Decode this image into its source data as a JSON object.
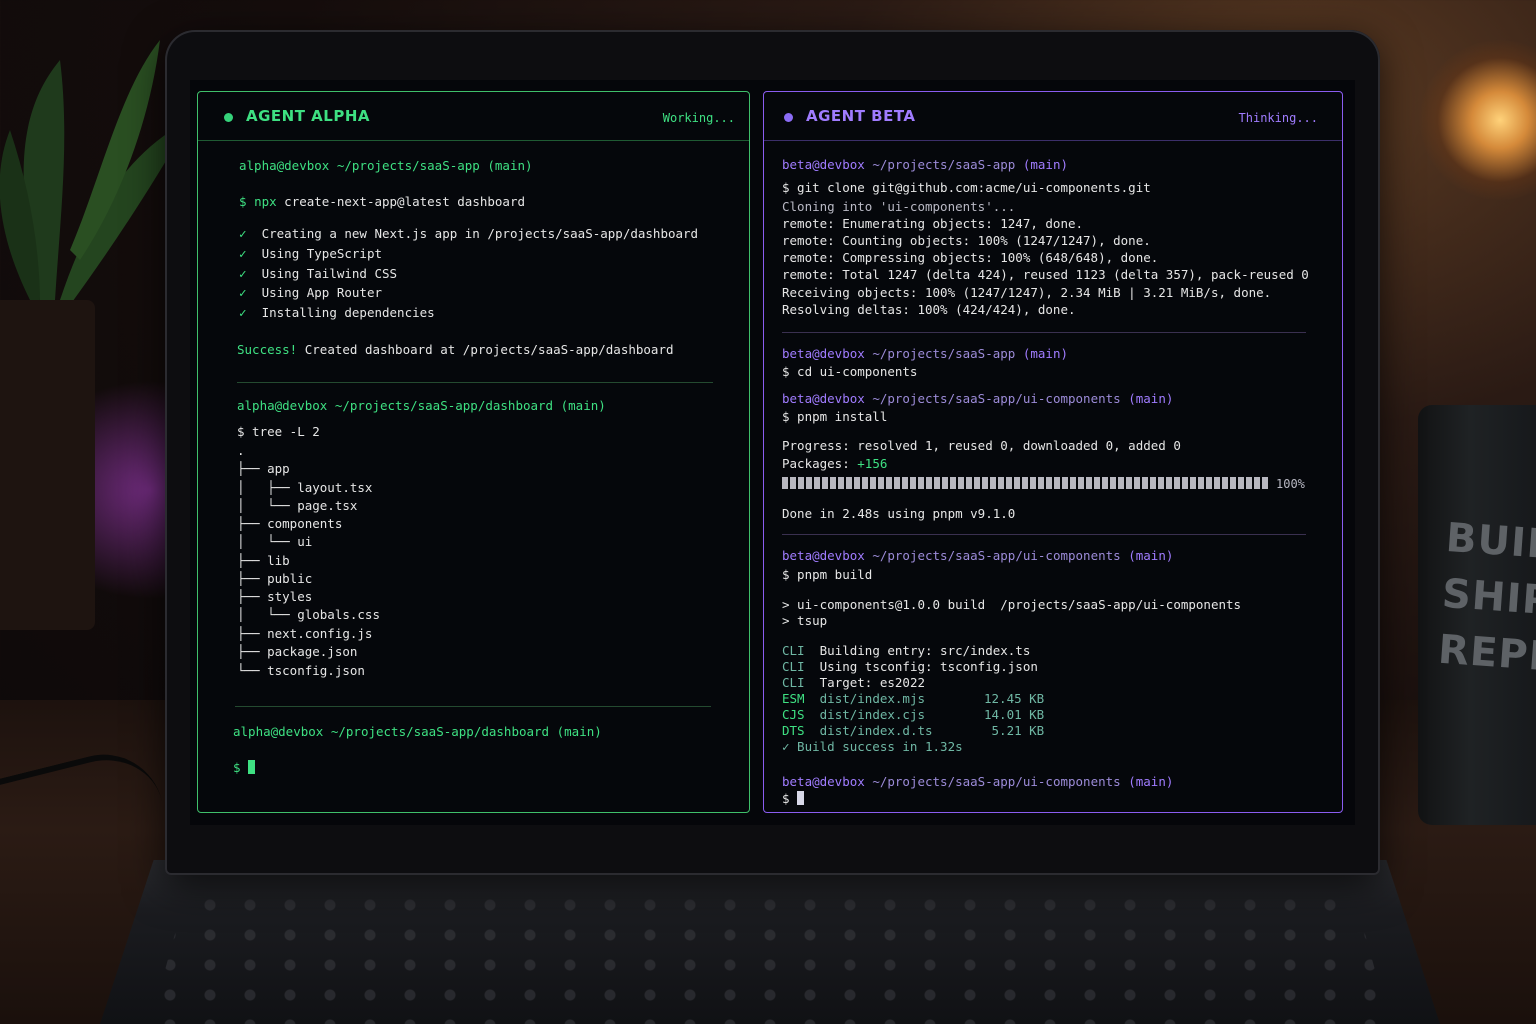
{
  "alpha": {
    "title": "AGENT ALPHA",
    "status": "Working...",
    "prompt1_user": "alpha@devbox",
    "prompt1_path": "~/projects/saaS-app",
    "prompt1_branch": "(main)",
    "cmd1_sign": "$",
    "cmd1_tool": "npx",
    "cmd1_args": "create-next-app@latest dashboard",
    "checks": [
      "Creating a new Next.js app in /projects/saaS-app/dashboard",
      "Using TypeScript",
      "Using Tailwind CSS",
      "Using App Router",
      "Installing dependencies"
    ],
    "check_mark": "✓",
    "success_label": "Success!",
    "success_text": "Created dashboard at /projects/saaS-app/dashboard",
    "prompt2_user": "alpha@devbox",
    "prompt2_path": "~/projects/saaS-app/dashboard",
    "prompt2_branch": "(main)",
    "cmd2": "$ tree -L 2",
    "tree": [
      ".",
      "├── app",
      "│   ├── layout.tsx",
      "│   └── page.tsx",
      "├── components",
      "│   └── ui",
      "├── lib",
      "├── public",
      "├── styles",
      "│   └── globals.css",
      "├── next.config.js",
      "├── package.json",
      "└── tsconfig.json"
    ],
    "prompt3_user": "alpha@devbox",
    "prompt3_path": "~/projects/saaS-app/dashboard",
    "prompt3_branch": "(main)",
    "final_sign": "$"
  },
  "beta": {
    "title": "AGENT BETA",
    "status": "Thinking...",
    "p1_user": "beta@devbox",
    "p1_path": "~/projects/saaS-app",
    "p1_branch": "(main)",
    "cmd_clone": "$ git clone git@github.com:acme/ui-components.git",
    "clone_lines": [
      "Cloning into 'ui-components'...",
      "remote: Enumerating objects: 1247, done.",
      "remote: Counting objects: 100% (1247/1247), done.",
      "remote: Compressing objects: 100% (648/648), done.",
      "remote: Total 1247 (delta 424), reused 1123 (delta 357), pack-reused 0",
      "Receiving objects: 100% (1247/1247), 2.34 MiB | 3.21 MiB/s, done.",
      "Resolving deltas: 100% (424/424), done."
    ],
    "p2_user": "beta@devbox",
    "p2_path": "~/projects/saaS-app",
    "p2_branch": "(main)",
    "cmd_cd": "$ cd ui-components",
    "p3_user": "beta@devbox",
    "p3_path": "~/projects/saaS-app/ui-components",
    "p3_branch": "(main)",
    "cmd_install": "$ pnpm install",
    "progress_line": "Progress: resolved 1, reused 0, downloaded 0, added 0",
    "packages_label": "Packages:",
    "packages_value": "+156",
    "progress_percent": "100%",
    "progress_fraction": 1.0,
    "done_line": "Done in 2.48s using pnpm v9.1.0",
    "p4_user": "beta@devbox",
    "p4_path": "~/projects/saaS-app/ui-components",
    "p4_branch": "(main)",
    "cmd_build": "$ pnpm build",
    "build_lines": [
      "> ui-components@1.0.0 build  /projects/saaS-app/ui-components",
      "> tsup"
    ],
    "cli_rows": [
      {
        "tag": "CLI",
        "text": "Building entry: src/index.ts"
      },
      {
        "tag": "CLI",
        "text": "Using tsconfig: tsconfig.json"
      },
      {
        "tag": "CLI",
        "text": "Target: es2022"
      }
    ],
    "out_rows": [
      {
        "tag": "ESM",
        "file": "dist/index.mjs",
        "size": "12.45 KB"
      },
      {
        "tag": "CJS",
        "file": "dist/index.cjs",
        "size": "14.01 KB"
      },
      {
        "tag": "DTS",
        "file": "dist/index.d.ts",
        "size": " 5.21 KB"
      }
    ],
    "build_success": "✓ Build success in 1.32s",
    "p5_user": "beta@devbox",
    "p5_path": "~/projects/saaS-app/ui-components",
    "p5_branch": "(main)",
    "final_sign": "$"
  },
  "mug_text": "BUILD\nSHIP\nREPEA",
  "colors": {
    "alpha_accent": "#3ee082",
    "beta_accent": "#a07cff"
  }
}
